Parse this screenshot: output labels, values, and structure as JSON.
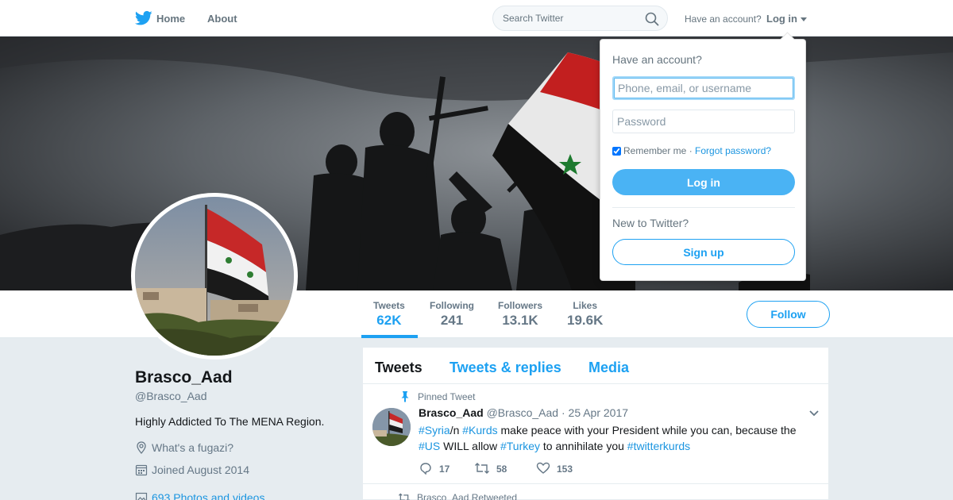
{
  "nav": {
    "home_label": "Home",
    "about_label": "About",
    "search_placeholder": "Search Twitter",
    "have_account": "Have an account?",
    "login_label": "Log in",
    "brand_color": "#1da1f2"
  },
  "profile_nav": {
    "stats": [
      {
        "label": "Tweets",
        "value": "62K"
      },
      {
        "label": "Following",
        "value": "241"
      },
      {
        "label": "Followers",
        "value": "13.1K"
      },
      {
        "label": "Likes",
        "value": "19.6K"
      }
    ],
    "follow_label": "Follow"
  },
  "profile": {
    "name": "Brasco_Aad",
    "handle": "@Brasco_Aad",
    "bio": "Highly Addicted To The MENA Region.",
    "location": "What's a fugazi?",
    "joined": "Joined August 2014",
    "media_link": "693 Photos and videos"
  },
  "timeline": {
    "tabs": [
      "Tweets",
      "Tweets & replies",
      "Media"
    ],
    "pinned_label": "Pinned Tweet",
    "tweet": {
      "name": "Brasco_Aad",
      "handle": "@Brasco_Aad",
      "separator": "·",
      "date": "25 Apr 2017",
      "parts": [
        {
          "text": "#Syria",
          "hash": true
        },
        {
          "text": "/n ",
          "hash": false
        },
        {
          "text": "#Kurds",
          "hash": true
        },
        {
          "text": " make peace with your President while you can, because the ",
          "hash": false
        },
        {
          "text": "#US",
          "hash": true
        },
        {
          "text": " WILL allow ",
          "hash": false
        },
        {
          "text": "#Turkey",
          "hash": true
        },
        {
          "text": " to annihilate you  ",
          "hash": false
        },
        {
          "text": "#twitterkurds",
          "hash": true
        }
      ],
      "replies": "17",
      "retweets": "58",
      "likes": "153"
    },
    "retweeted_label": "Brasco_Aad Retweeted"
  },
  "login_dropdown": {
    "title": "Have an account?",
    "username_placeholder": "Phone, email, or username",
    "password_placeholder": "Password",
    "remember_label": "Remember me",
    "separator": "·",
    "forgot_label": "Forgot password?",
    "login_button": "Log in",
    "new_label": "New to Twitter?",
    "signup_button": "Sign up"
  }
}
